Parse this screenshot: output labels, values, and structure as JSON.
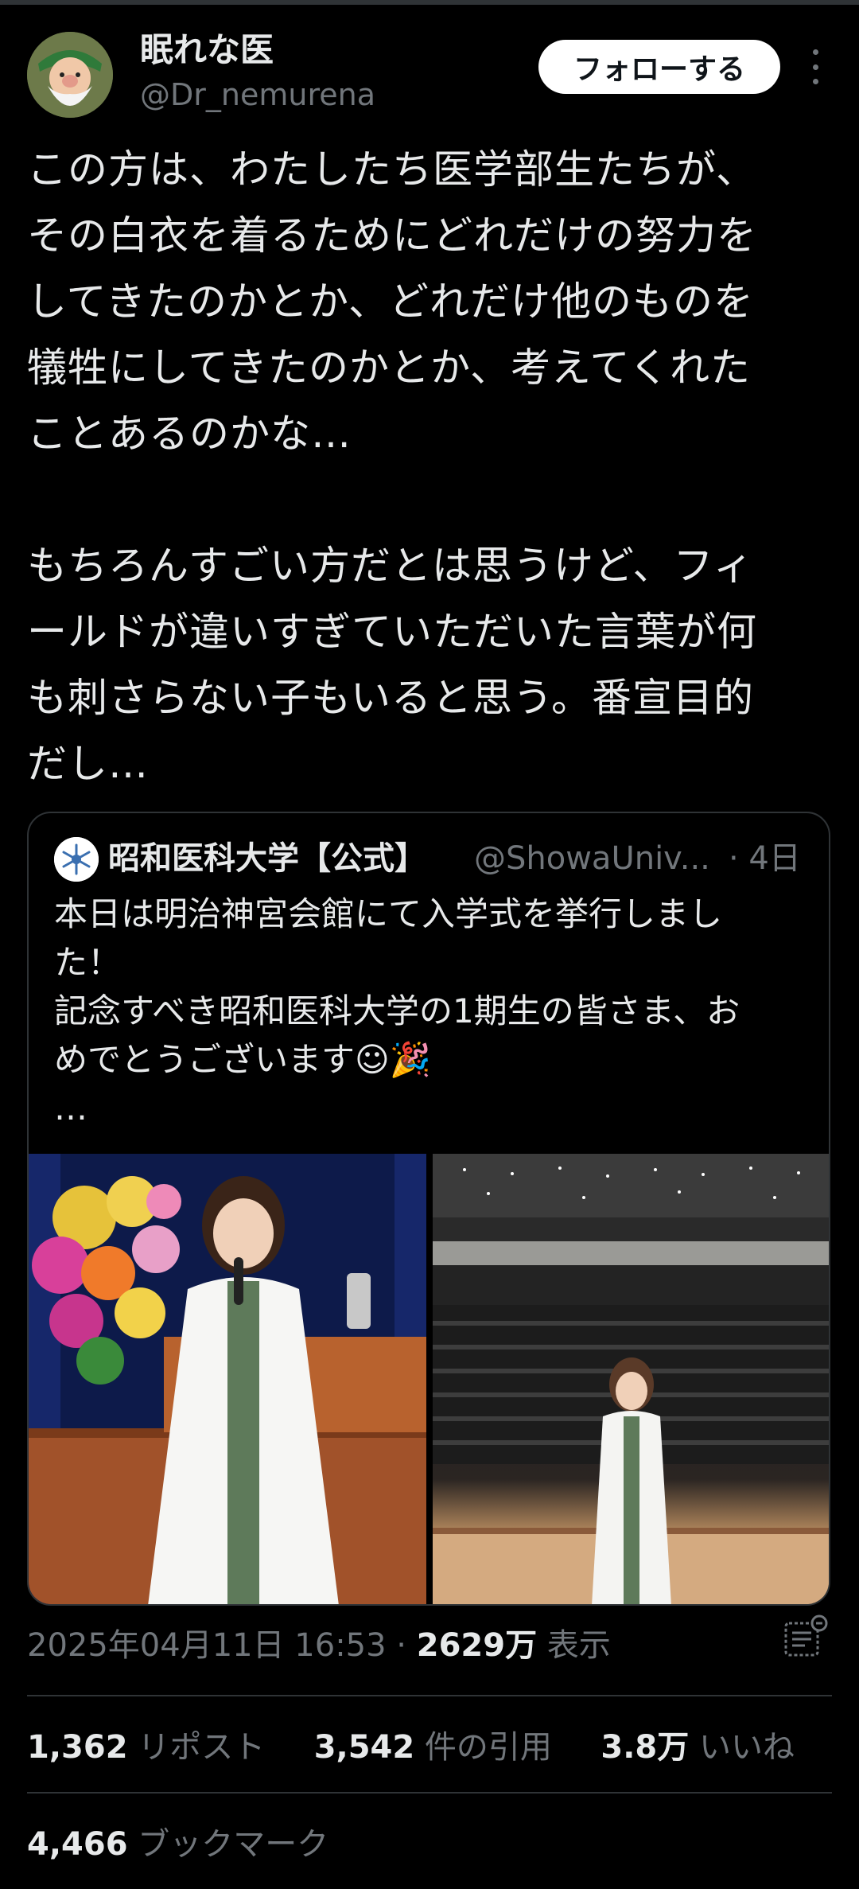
{
  "author": {
    "name": "眠れな医",
    "handle": "@Dr_nemurena",
    "follow_label": "フォローする"
  },
  "tweet": {
    "text": "この方は、わたしたち医学部生たちが、\nその白衣を着るためにどれだけの努力を\nしてきたのかとか、どれだけ他のものを\n犠牲にしてきたのかとか、考えてくれた\nことあるのかな…\n\nもちろんすごい方だとは思うけど、フィ\nールドが違いすぎていただいた言葉が何\nも刺さらない子もいると思う。番宣目的\nだし…"
  },
  "quoted_tweet": {
    "name": "昭和医科大学【公式】",
    "handle": "@ShowaUniv...",
    "time": "· 4日",
    "text": "本日は明治神宮会館にて入学式を挙行しまし\nた！\n記念すべき昭和医科大学の1期生の皆さま、お\nめでとうございます☺🎉\n…"
  },
  "meta": {
    "datetime": "2025年04月11日 16:53 · ",
    "views_count": "2629万",
    "views_label": " 表示"
  },
  "stats": {
    "reposts_count": "1,362",
    "reposts_label": " リポスト",
    "quotes_count": "3,542",
    "quotes_label": " 件の引用",
    "likes_count": "3.8万",
    "likes_label": " いいね",
    "bookmarks_count": "4,466",
    "bookmarks_label": " ブックマーク"
  },
  "colors": {
    "background": "#000000",
    "text": "#e7e9ea",
    "secondary": "#71767b",
    "border": "#2f3336"
  }
}
